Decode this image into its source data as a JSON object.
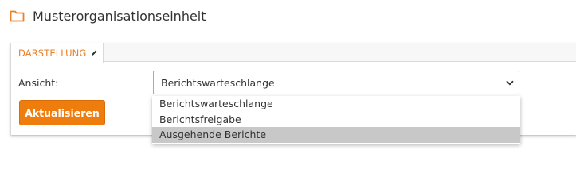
{
  "header": {
    "title": "Musterorganisationseinheit",
    "icon": "folder-icon",
    "icon_color": "#e8812a"
  },
  "tabs": [
    {
      "label": "DARSTELLUNG",
      "icon": "pencil-icon",
      "active": true
    }
  ],
  "view_field": {
    "label": "Ansicht:",
    "selected": "Berichtswarteschlange",
    "options": [
      "Berichtswarteschlange",
      "Berichtsfreigabe",
      "Ausgehende Berichte"
    ],
    "highlighted_option": "Ausgehende Berichte"
  },
  "refresh_button": {
    "label": "Aktualisieren",
    "color": "#ef7d0d"
  }
}
